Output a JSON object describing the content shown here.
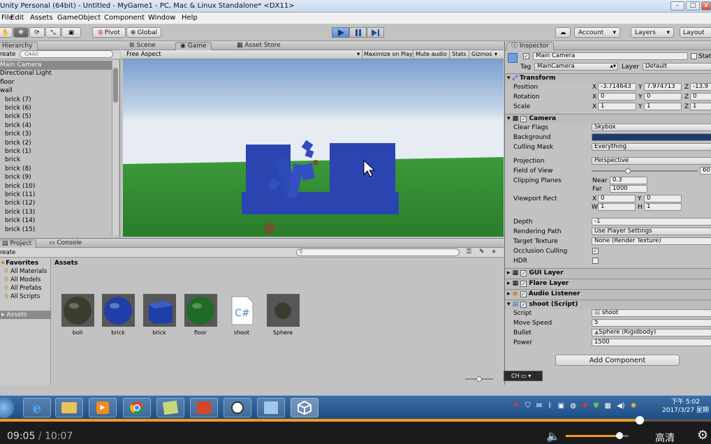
{
  "window": {
    "title": "Unity Personal (64bit) - Untitled - MyGame1 - PC, Mac & Linux Standalone* <DX11>"
  },
  "menu": [
    "File",
    "Edit",
    "Assets",
    "GameObject",
    "Component",
    "Window",
    "Help"
  ],
  "toolbar": {
    "pivot": "Pivot",
    "global": "Global",
    "account": "Account",
    "layers": "Layers",
    "layout": "Layout"
  },
  "hierarchy": {
    "tab": "Hierarchy",
    "create": "reate",
    "search_placeholder": "G▾All",
    "items": [
      "Main Camera",
      "Directional Light",
      "floor",
      "wall",
      "brick (7)",
      "brick (6)",
      "brick (5)",
      "brick (4)",
      "brick (3)",
      "brick (2)",
      "brick (1)",
      "brick",
      "brick (8)",
      "brick (9)",
      "brick (10)",
      "brick (11)",
      "brick (12)",
      "brick (13)",
      "brick (14)",
      "brick (15)"
    ],
    "selected_index": 0
  },
  "game": {
    "tabs": [
      "Scene",
      "Game",
      "Asset Store"
    ],
    "aspect": "Free Aspect",
    "options": [
      "Maximize on Play",
      "Mute audio",
      "Stats",
      "Gizmos"
    ]
  },
  "project": {
    "tabs": [
      "Project",
      "Console"
    ],
    "create": "reate",
    "favorites_label": "Favorites",
    "favorites": [
      "All Materials",
      "All Models",
      "All Prefabs",
      "All Scripts"
    ],
    "assets_folder": "Assets",
    "assets_header": "Assets",
    "assets": [
      {
        "name": "boll",
        "kind": "material",
        "color": "#3d3d2e"
      },
      {
        "name": "brick",
        "kind": "material",
        "color": "#1f3ea8"
      },
      {
        "name": "brick",
        "kind": "cube",
        "color": "#1f3ea8"
      },
      {
        "name": "floor",
        "kind": "material",
        "color": "#1e6b24"
      },
      {
        "name": "shoot",
        "kind": "script",
        "color": "#ffffff"
      },
      {
        "name": "Sphere",
        "kind": "prefab",
        "color": "#3d3d2e"
      }
    ]
  },
  "inspector": {
    "tab": "Inspector",
    "object_name": "Main Camera",
    "static_label": "Stat",
    "tag_label": "Tag",
    "tag": "MainCamera",
    "layer_label": "Layer",
    "layer": "Default",
    "transform": {
      "title": "Transform",
      "position_label": "Position",
      "rotation_label": "Rotation",
      "scale_label": "Scale",
      "px": "-3.714643",
      "py": "7.974713",
      "pz": "-13.9",
      "rx": "0",
      "ry": "0",
      "rz": "0",
      "sx": "1",
      "sy": "1",
      "sz": "1"
    },
    "camera": {
      "title": "Camera",
      "clear_flags_label": "Clear Flags",
      "clear_flags": "Skybox",
      "background_label": "Background",
      "culling_label": "Culling Mask",
      "culling": "Everything",
      "projection_label": "Projection",
      "projection": "Perspective",
      "fov_label": "Field of View",
      "fov": "60",
      "clipping_label": "Clipping Planes",
      "near_label": "Near",
      "near": "0.3",
      "far_label": "Far",
      "far": "1000",
      "viewport_label": "Viewport Rect",
      "vx": "0",
      "vy": "0",
      "vw": "1",
      "vh": "1",
      "depth_label": "Depth",
      "depth": "-1",
      "rendering_label": "Rendering Path",
      "rendering": "Use Player Settings",
      "target_label": "Target Texture",
      "target": "None (Render Texture)",
      "occlusion_label": "Occlusion Culling",
      "hdr_label": "HDR"
    },
    "components": [
      "GUI Layer",
      "Flare Layer",
      "Audio Listener",
      "shoot (Script)"
    ],
    "shoot": {
      "script_label": "Script",
      "script": "shoot",
      "speed_label": "Move Speed",
      "speed": "5",
      "bullet_label": "Bullet",
      "bullet": "Sphere (Rigidbody)",
      "power_label": "Power",
      "power": "1500"
    },
    "add_component": "Add Component"
  },
  "ime": "CH",
  "tray": {
    "time": "下午 5:02",
    "date": "2017/3/27 星期"
  },
  "player": {
    "current": "09:05",
    "sep": "/",
    "total": "10:07",
    "quality": "高清",
    "progress": 0.9,
    "volume": 0.85
  }
}
